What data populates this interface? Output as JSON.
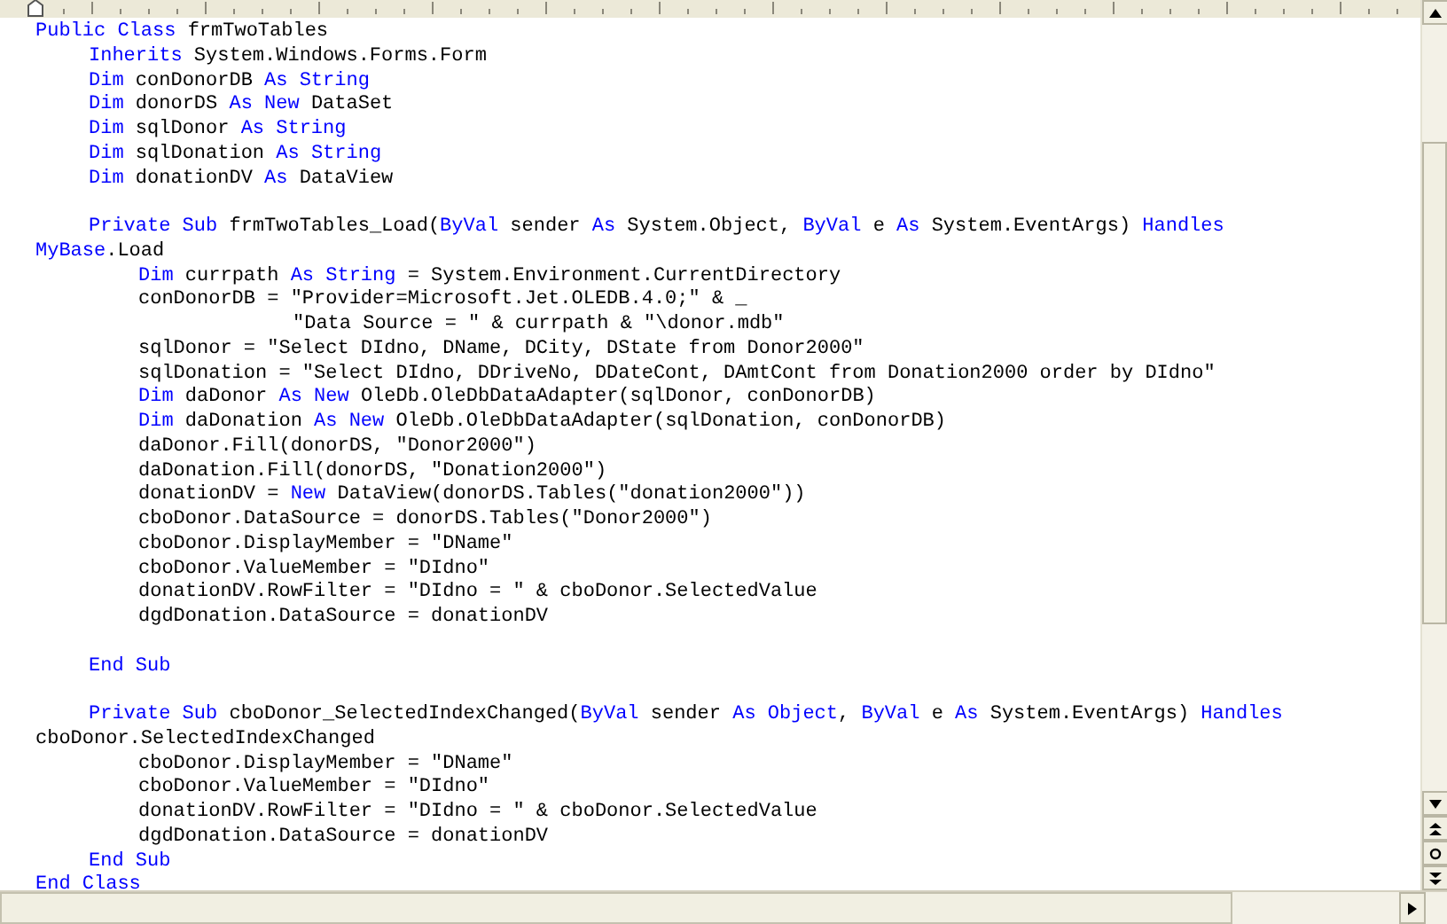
{
  "document": {
    "lines": [
      {
        "kind": "flush",
        "tokens": [
          {
            "text": "Public Class",
            "keyword": true
          },
          {
            "text": " frmTwoTables",
            "keyword": false
          }
        ]
      },
      {
        "kind": "inner",
        "tokens": [
          {
            "text": "Inherits",
            "keyword": true
          },
          {
            "text": " System.Windows.Forms.Form",
            "keyword": false
          }
        ]
      },
      {
        "kind": "inner",
        "tokens": [
          {
            "text": "Dim",
            "keyword": true
          },
          {
            "text": " conDonorDB ",
            "keyword": false
          },
          {
            "text": "As String",
            "keyword": true
          }
        ]
      },
      {
        "kind": "inner",
        "tokens": [
          {
            "text": "Dim",
            "keyword": true
          },
          {
            "text": " donorDS ",
            "keyword": false
          },
          {
            "text": "As New",
            "keyword": true
          },
          {
            "text": " DataSet",
            "keyword": false
          }
        ]
      },
      {
        "kind": "inner",
        "tokens": [
          {
            "text": "Dim",
            "keyword": true
          },
          {
            "text": " sqlDonor ",
            "keyword": false
          },
          {
            "text": "As String",
            "keyword": true
          }
        ]
      },
      {
        "kind": "inner",
        "tokens": [
          {
            "text": "Dim",
            "keyword": true
          },
          {
            "text": " sqlDonation ",
            "keyword": false
          },
          {
            "text": "As String",
            "keyword": true
          }
        ]
      },
      {
        "kind": "inner",
        "tokens": [
          {
            "text": "Dim",
            "keyword": true
          },
          {
            "text": " donationDV ",
            "keyword": false
          },
          {
            "text": "As",
            "keyword": true
          },
          {
            "text": " DataView",
            "keyword": false
          }
        ]
      },
      {
        "kind": "blank"
      },
      {
        "kind": "inner",
        "tokens": [
          {
            "text": "Private Sub",
            "keyword": true
          },
          {
            "text": " frmTwoTables_Load(",
            "keyword": false
          },
          {
            "text": "ByVal",
            "keyword": true
          },
          {
            "text": " sender ",
            "keyword": false
          },
          {
            "text": "As",
            "keyword": true
          },
          {
            "text": " System.Object, ",
            "keyword": false
          },
          {
            "text": "ByVal",
            "keyword": true
          },
          {
            "text": " e ",
            "keyword": false
          },
          {
            "text": "As",
            "keyword": true
          },
          {
            "text": " System.EventArgs) ",
            "keyword": false
          },
          {
            "text": "Handles",
            "keyword": true
          }
        ]
      },
      {
        "kind": "flush",
        "tokens": [
          {
            "text": "MyBase",
            "keyword": true
          },
          {
            "text": ".Load",
            "keyword": false
          }
        ]
      },
      {
        "kind": "body",
        "tokens": [
          {
            "text": "Dim",
            "keyword": true
          },
          {
            "text": " currpath ",
            "keyword": false
          },
          {
            "text": "As String",
            "keyword": true
          },
          {
            "text": " = System.Environment.CurrentDirectory",
            "keyword": false
          }
        ]
      },
      {
        "kind": "body",
        "tokens": [
          {
            "text": "conDonorDB = \"Provider=Microsoft.Jet.OLEDB.4.0;\" & _",
            "keyword": false
          }
        ]
      },
      {
        "kind": "deep",
        "tokens": [
          {
            "text": "\"Data Source = \" & currpath & \"\\donor.mdb\"",
            "keyword": false
          }
        ]
      },
      {
        "kind": "body",
        "tokens": [
          {
            "text": "sqlDonor = \"Select DIdno, DName, DCity, DState from Donor2000\"",
            "keyword": false
          }
        ]
      },
      {
        "kind": "body",
        "tokens": [
          {
            "text": "sqlDonation = \"Select DIdno, DDriveNo, DDateCont, DAmtCont from Donation2000 order by DIdno\"",
            "keyword": false
          }
        ]
      },
      {
        "kind": "body",
        "tokens": [
          {
            "text": "Dim",
            "keyword": true
          },
          {
            "text": " daDonor ",
            "keyword": false
          },
          {
            "text": "As New",
            "keyword": true
          },
          {
            "text": " OleDb.OleDbDataAdapter(sqlDonor, conDonorDB)",
            "keyword": false
          }
        ]
      },
      {
        "kind": "body",
        "tokens": [
          {
            "text": "Dim",
            "keyword": true
          },
          {
            "text": " daDonation ",
            "keyword": false
          },
          {
            "text": "As New",
            "keyword": true
          },
          {
            "text": " OleDb.OleDbDataAdapter(sqlDonation, conDonorDB)",
            "keyword": false
          }
        ]
      },
      {
        "kind": "body",
        "tokens": [
          {
            "text": "daDonor.Fill(donorDS, \"Donor2000\")",
            "keyword": false
          }
        ]
      },
      {
        "kind": "body",
        "tokens": [
          {
            "text": "daDonation.Fill(donorDS, \"Donation2000\")",
            "keyword": false
          }
        ]
      },
      {
        "kind": "body",
        "tokens": [
          {
            "text": "donationDV = ",
            "keyword": false
          },
          {
            "text": "New",
            "keyword": true
          },
          {
            "text": " DataView(donorDS.Tables(\"donation2000\"))",
            "keyword": false
          }
        ]
      },
      {
        "kind": "body",
        "tokens": [
          {
            "text": "cboDonor.DataSource = donorDS.Tables(\"Donor2000\")",
            "keyword": false
          }
        ]
      },
      {
        "kind": "body",
        "tokens": [
          {
            "text": "cboDonor.DisplayMember = \"DName\"",
            "keyword": false
          }
        ]
      },
      {
        "kind": "body",
        "tokens": [
          {
            "text": "cboDonor.ValueMember = \"DIdno\"",
            "keyword": false
          }
        ]
      },
      {
        "kind": "body",
        "tokens": [
          {
            "text": "donationDV.RowFilter = \"DIdno = \" & cboDonor.SelectedValue",
            "keyword": false
          }
        ]
      },
      {
        "kind": "body",
        "tokens": [
          {
            "text": "dgdDonation.DataSource = donationDV",
            "keyword": false
          }
        ]
      },
      {
        "kind": "blank"
      },
      {
        "kind": "inner",
        "tokens": [
          {
            "text": "End Sub",
            "keyword": true
          }
        ]
      },
      {
        "kind": "blank"
      },
      {
        "kind": "inner",
        "tokens": [
          {
            "text": "Private Sub",
            "keyword": true
          },
          {
            "text": " cboDonor_SelectedIndexChanged(",
            "keyword": false
          },
          {
            "text": "ByVal",
            "keyword": true
          },
          {
            "text": " sender ",
            "keyword": false
          },
          {
            "text": "As Object",
            "keyword": true
          },
          {
            "text": ", ",
            "keyword": false
          },
          {
            "text": "ByVal",
            "keyword": true
          },
          {
            "text": " e ",
            "keyword": false
          },
          {
            "text": "As",
            "keyword": true
          },
          {
            "text": " System.EventArgs) ",
            "keyword": false
          },
          {
            "text": "Handles",
            "keyword": true
          }
        ]
      },
      {
        "kind": "flush",
        "tokens": [
          {
            "text": "cboDonor.SelectedIndexChanged",
            "keyword": false
          }
        ]
      },
      {
        "kind": "body",
        "tokens": [
          {
            "text": "cboDonor.DisplayMember = \"DName\"",
            "keyword": false
          }
        ]
      },
      {
        "kind": "body",
        "tokens": [
          {
            "text": "cboDonor.ValueMember = \"DIdno\"",
            "keyword": false
          }
        ]
      },
      {
        "kind": "body",
        "tokens": [
          {
            "text": "donationDV.RowFilter = \"DIdno = \" & cboDonor.SelectedValue",
            "keyword": false
          }
        ]
      },
      {
        "kind": "body",
        "tokens": [
          {
            "text": "dgdDonation.DataSource = donationDV",
            "keyword": false
          }
        ]
      },
      {
        "kind": "inner",
        "tokens": [
          {
            "text": "End Sub",
            "keyword": true
          }
        ]
      },
      {
        "kind": "flush",
        "tokens": [
          {
            "text": "End Class",
            "keyword": true
          }
        ]
      }
    ]
  }
}
